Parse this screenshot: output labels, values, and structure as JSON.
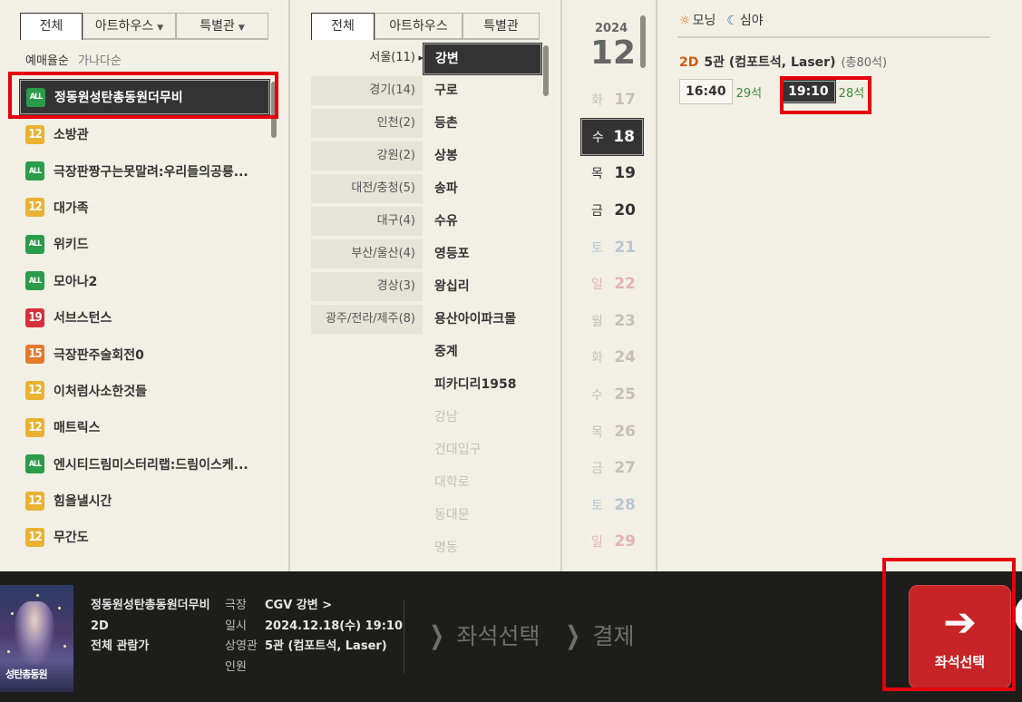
{
  "movie_panel": {
    "tabs": [
      "전체",
      "아트하우스",
      "특별관"
    ],
    "sort": [
      "예매율순",
      "가나다순"
    ],
    "movies": [
      {
        "rating": "ALL",
        "title": "정동원성탄총동원더무비"
      },
      {
        "rating": "12",
        "title": "소방관"
      },
      {
        "rating": "ALL",
        "title": "극장판짱구는못말려:우리들의공룡..."
      },
      {
        "rating": "12",
        "title": "대가족"
      },
      {
        "rating": "ALL",
        "title": "위키드"
      },
      {
        "rating": "ALL",
        "title": "모아나2"
      },
      {
        "rating": "19",
        "title": "서브스턴스"
      },
      {
        "rating": "15",
        "title": "극장판주술회전0"
      },
      {
        "rating": "12",
        "title": "이처럼사소한것들"
      },
      {
        "rating": "12",
        "title": "매트릭스"
      },
      {
        "rating": "ALL",
        "title": "엔시티드림미스터리랩:드림이스케..."
      },
      {
        "rating": "12",
        "title": "힘을낼시간"
      },
      {
        "rating": "12",
        "title": "무간도"
      }
    ]
  },
  "theater_panel": {
    "tabs": [
      "전체",
      "아트하우스",
      "특별관"
    ],
    "regions": [
      "서울(11)",
      "경기(14)",
      "인천(2)",
      "강원(2)",
      "대전/충청(5)",
      "대구(4)",
      "부산/울산(4)",
      "경상(3)",
      "광주/전라/제주(8)"
    ],
    "theaters": [
      {
        "name": "강변",
        "state": "selected"
      },
      {
        "name": "구로",
        "state": "normal"
      },
      {
        "name": "등촌",
        "state": "normal"
      },
      {
        "name": "상봉",
        "state": "normal"
      },
      {
        "name": "송파",
        "state": "normal"
      },
      {
        "name": "수유",
        "state": "normal"
      },
      {
        "name": "영등포",
        "state": "normal"
      },
      {
        "name": "왕십리",
        "state": "normal"
      },
      {
        "name": "용산아이파크몰",
        "state": "normal"
      },
      {
        "name": "중계",
        "state": "normal"
      },
      {
        "name": "피카디리1958",
        "state": "normal"
      },
      {
        "name": "강남",
        "state": "disabled"
      },
      {
        "name": "건대입구",
        "state": "disabled"
      },
      {
        "name": "대학로",
        "state": "disabled"
      },
      {
        "name": "동대문",
        "state": "disabled"
      },
      {
        "name": "명동",
        "state": "disabled"
      }
    ]
  },
  "date_panel": {
    "year": "2024",
    "month": "12",
    "dates": [
      {
        "dow": "화",
        "day": "17",
        "state": "dis"
      },
      {
        "dow": "수",
        "day": "18",
        "state": "selected"
      },
      {
        "dow": "목",
        "day": "19",
        "state": "normal"
      },
      {
        "dow": "금",
        "day": "20",
        "state": "normal"
      },
      {
        "dow": "토",
        "day": "21",
        "state": "dis-sat"
      },
      {
        "dow": "일",
        "day": "22",
        "state": "dis-sun"
      },
      {
        "dow": "월",
        "day": "23",
        "state": "dis"
      },
      {
        "dow": "화",
        "day": "24",
        "state": "dis"
      },
      {
        "dow": "수",
        "day": "25",
        "state": "dis"
      },
      {
        "dow": "목",
        "day": "26",
        "state": "dis"
      },
      {
        "dow": "금",
        "day": "27",
        "state": "dis"
      },
      {
        "dow": "토",
        "day": "28",
        "state": "dis-sat"
      },
      {
        "dow": "일",
        "day": "29",
        "state": "dis-sun"
      }
    ]
  },
  "time_panel": {
    "morning_label": "모닝",
    "night_label": "심야",
    "screen_format": "2D",
    "screen_name": "5관 (컴포트석, Laser)",
    "screen_total": "(총80석)",
    "showtimes": [
      {
        "time": "16:40",
        "seats": "29석",
        "selected": false
      },
      {
        "time": "19:10",
        "seats": "28석",
        "selected": true
      }
    ]
  },
  "bottom_bar": {
    "poster_text": "성탄총동원",
    "movie_title": "정동원성탄총동원더무비",
    "movie_format": "2D",
    "movie_rating": "전체 관람가",
    "labels": {
      "theater": "극장",
      "datetime": "일시",
      "screen": "상영관",
      "people": "인원"
    },
    "values": {
      "theater": "CGV 강변 >",
      "datetime": "2024.12.18(수) 19:10",
      "screen": "5관 (컴포트석, Laser)",
      "people": ""
    },
    "step_seat": "좌석선택",
    "step_pay": "결제",
    "next_button": "좌석선택"
  },
  "colors": {
    "panel_bg": "#f2f0e5",
    "selected_bg": "#333333",
    "highlight_red": "#e5000a",
    "rating_all": "#2a9c4a",
    "rating_12": "#e9b231",
    "rating_15": "#e5792b",
    "rating_19": "#d5303b",
    "next_button": "#c82327"
  }
}
